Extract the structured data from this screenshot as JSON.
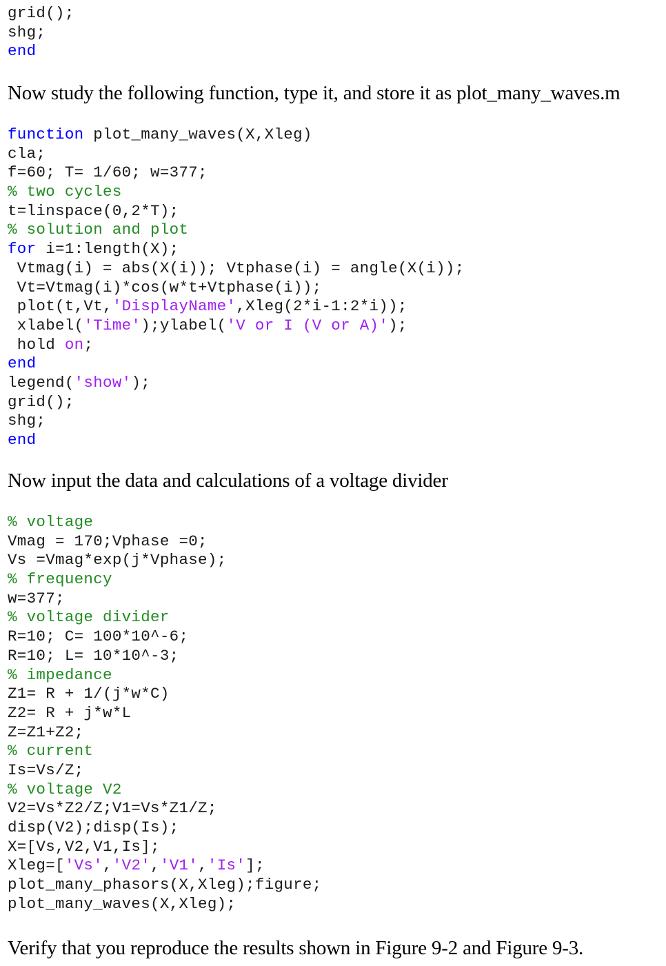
{
  "code_top": {
    "lines": [
      [
        {
          "t": "tx",
          "s": "grid();"
        }
      ],
      [
        {
          "t": "tx",
          "s": "shg;"
        }
      ],
      [
        {
          "t": "kw",
          "s": "end"
        }
      ]
    ]
  },
  "prose_1": "Now study the following function, type it, and store it as plot_many_waves.m",
  "code_function": {
    "lines": [
      [
        {
          "t": "kw",
          "s": "function"
        },
        {
          "t": "tx",
          "s": " plot_many_waves(X,Xleg)"
        }
      ],
      [
        {
          "t": "tx",
          "s": "cla;"
        }
      ],
      [
        {
          "t": "tx",
          "s": "f=60; T= 1/60; w=377;"
        }
      ],
      [
        {
          "t": "cm",
          "s": "% two cycles"
        }
      ],
      [
        {
          "t": "tx",
          "s": "t=linspace(0,2*T);"
        }
      ],
      [
        {
          "t": "cm",
          "s": "% solution and plot"
        }
      ],
      [
        {
          "t": "kw",
          "s": "for"
        },
        {
          "t": "tx",
          "s": " i=1:length(X);"
        }
      ],
      [
        {
          "t": "tx",
          "s": " Vtmag(i) = abs(X(i)); Vtphase(i) = angle(X(i));"
        }
      ],
      [
        {
          "t": "tx",
          "s": " Vt=Vtmag(i)*cos(w*t+Vtphase(i));"
        }
      ],
      [
        {
          "t": "tx",
          "s": " plot(t,Vt,"
        },
        {
          "t": "str",
          "s": "'DisplayName'"
        },
        {
          "t": "tx",
          "s": ",Xleg(2*i-1:2*i));"
        }
      ],
      [
        {
          "t": "tx",
          "s": " xlabel("
        },
        {
          "t": "str",
          "s": "'Time'"
        },
        {
          "t": "tx",
          "s": ");ylabel("
        },
        {
          "t": "str",
          "s": "'V or I (V or A)'"
        },
        {
          "t": "tx",
          "s": ");"
        }
      ],
      [
        {
          "t": "tx",
          "s": " hold "
        },
        {
          "t": "str",
          "s": "on"
        },
        {
          "t": "tx",
          "s": ";"
        }
      ],
      [
        {
          "t": "kw",
          "s": "end"
        }
      ],
      [
        {
          "t": "tx",
          "s": "legend("
        },
        {
          "t": "str",
          "s": "'show'"
        },
        {
          "t": "tx",
          "s": ");"
        }
      ],
      [
        {
          "t": "tx",
          "s": "grid();"
        }
      ],
      [
        {
          "t": "tx",
          "s": "shg;"
        }
      ],
      [
        {
          "t": "kw",
          "s": "end"
        }
      ]
    ]
  },
  "prose_2": "Now input the data and calculations of a voltage divider",
  "code_main": {
    "lines": [
      [
        {
          "t": "cm",
          "s": "% voltage"
        }
      ],
      [
        {
          "t": "tx",
          "s": "Vmag = 170;Vphase =0;"
        }
      ],
      [
        {
          "t": "tx",
          "s": "Vs =Vmag*exp(j*Vphase);"
        }
      ],
      [
        {
          "t": "cm",
          "s": "% frequency"
        }
      ],
      [
        {
          "t": "tx",
          "s": "w=377;"
        }
      ],
      [
        {
          "t": "cm",
          "s": "% voltage divider"
        }
      ],
      [
        {
          "t": "tx",
          "s": "R=10; C= 100*10^-6;"
        }
      ],
      [
        {
          "t": "tx",
          "s": "R=10; L= 10*10^-3;"
        }
      ],
      [
        {
          "t": "cm",
          "s": "% impedance"
        }
      ],
      [
        {
          "t": "tx",
          "s": "Z1= R + 1/(j*w*C)"
        }
      ],
      [
        {
          "t": "tx",
          "s": "Z2= R + j*w*L"
        }
      ],
      [
        {
          "t": "tx",
          "s": "Z=Z1+Z2;"
        }
      ],
      [
        {
          "t": "cm",
          "s": "% current"
        }
      ],
      [
        {
          "t": "tx",
          "s": "Is=Vs/Z;"
        }
      ],
      [
        {
          "t": "cm",
          "s": "% voltage V2"
        }
      ],
      [
        {
          "t": "tx",
          "s": "V2=Vs*Z2/Z;V1=Vs*Z1/Z;"
        }
      ],
      [
        {
          "t": "tx",
          "s": "disp(V2);disp(Is);"
        }
      ],
      [
        {
          "t": "tx",
          "s": "X=[Vs,V2,V1,Is];"
        }
      ],
      [
        {
          "t": "tx",
          "s": "Xleg=["
        },
        {
          "t": "str",
          "s": "'Vs'"
        },
        {
          "t": "tx",
          "s": ","
        },
        {
          "t": "str",
          "s": "'V2'"
        },
        {
          "t": "tx",
          "s": ","
        },
        {
          "t": "str",
          "s": "'V1'"
        },
        {
          "t": "tx",
          "s": ","
        },
        {
          "t": "str",
          "s": "'Is'"
        },
        {
          "t": "tx",
          "s": "];"
        }
      ],
      [
        {
          "t": "tx",
          "s": "plot_many_phasors(X,Xleg);figure;"
        }
      ],
      [
        {
          "t": "tx",
          "s": "plot_many_waves(X,Xleg);"
        }
      ]
    ]
  },
  "prose_3": "Verify that you reproduce the results shown in Figure 9-2 and Figure 9-3.",
  "colors": {
    "keyword": "#0000ff",
    "comment": "#228b22",
    "string": "#a020f0",
    "text": "#1a1a1a"
  }
}
